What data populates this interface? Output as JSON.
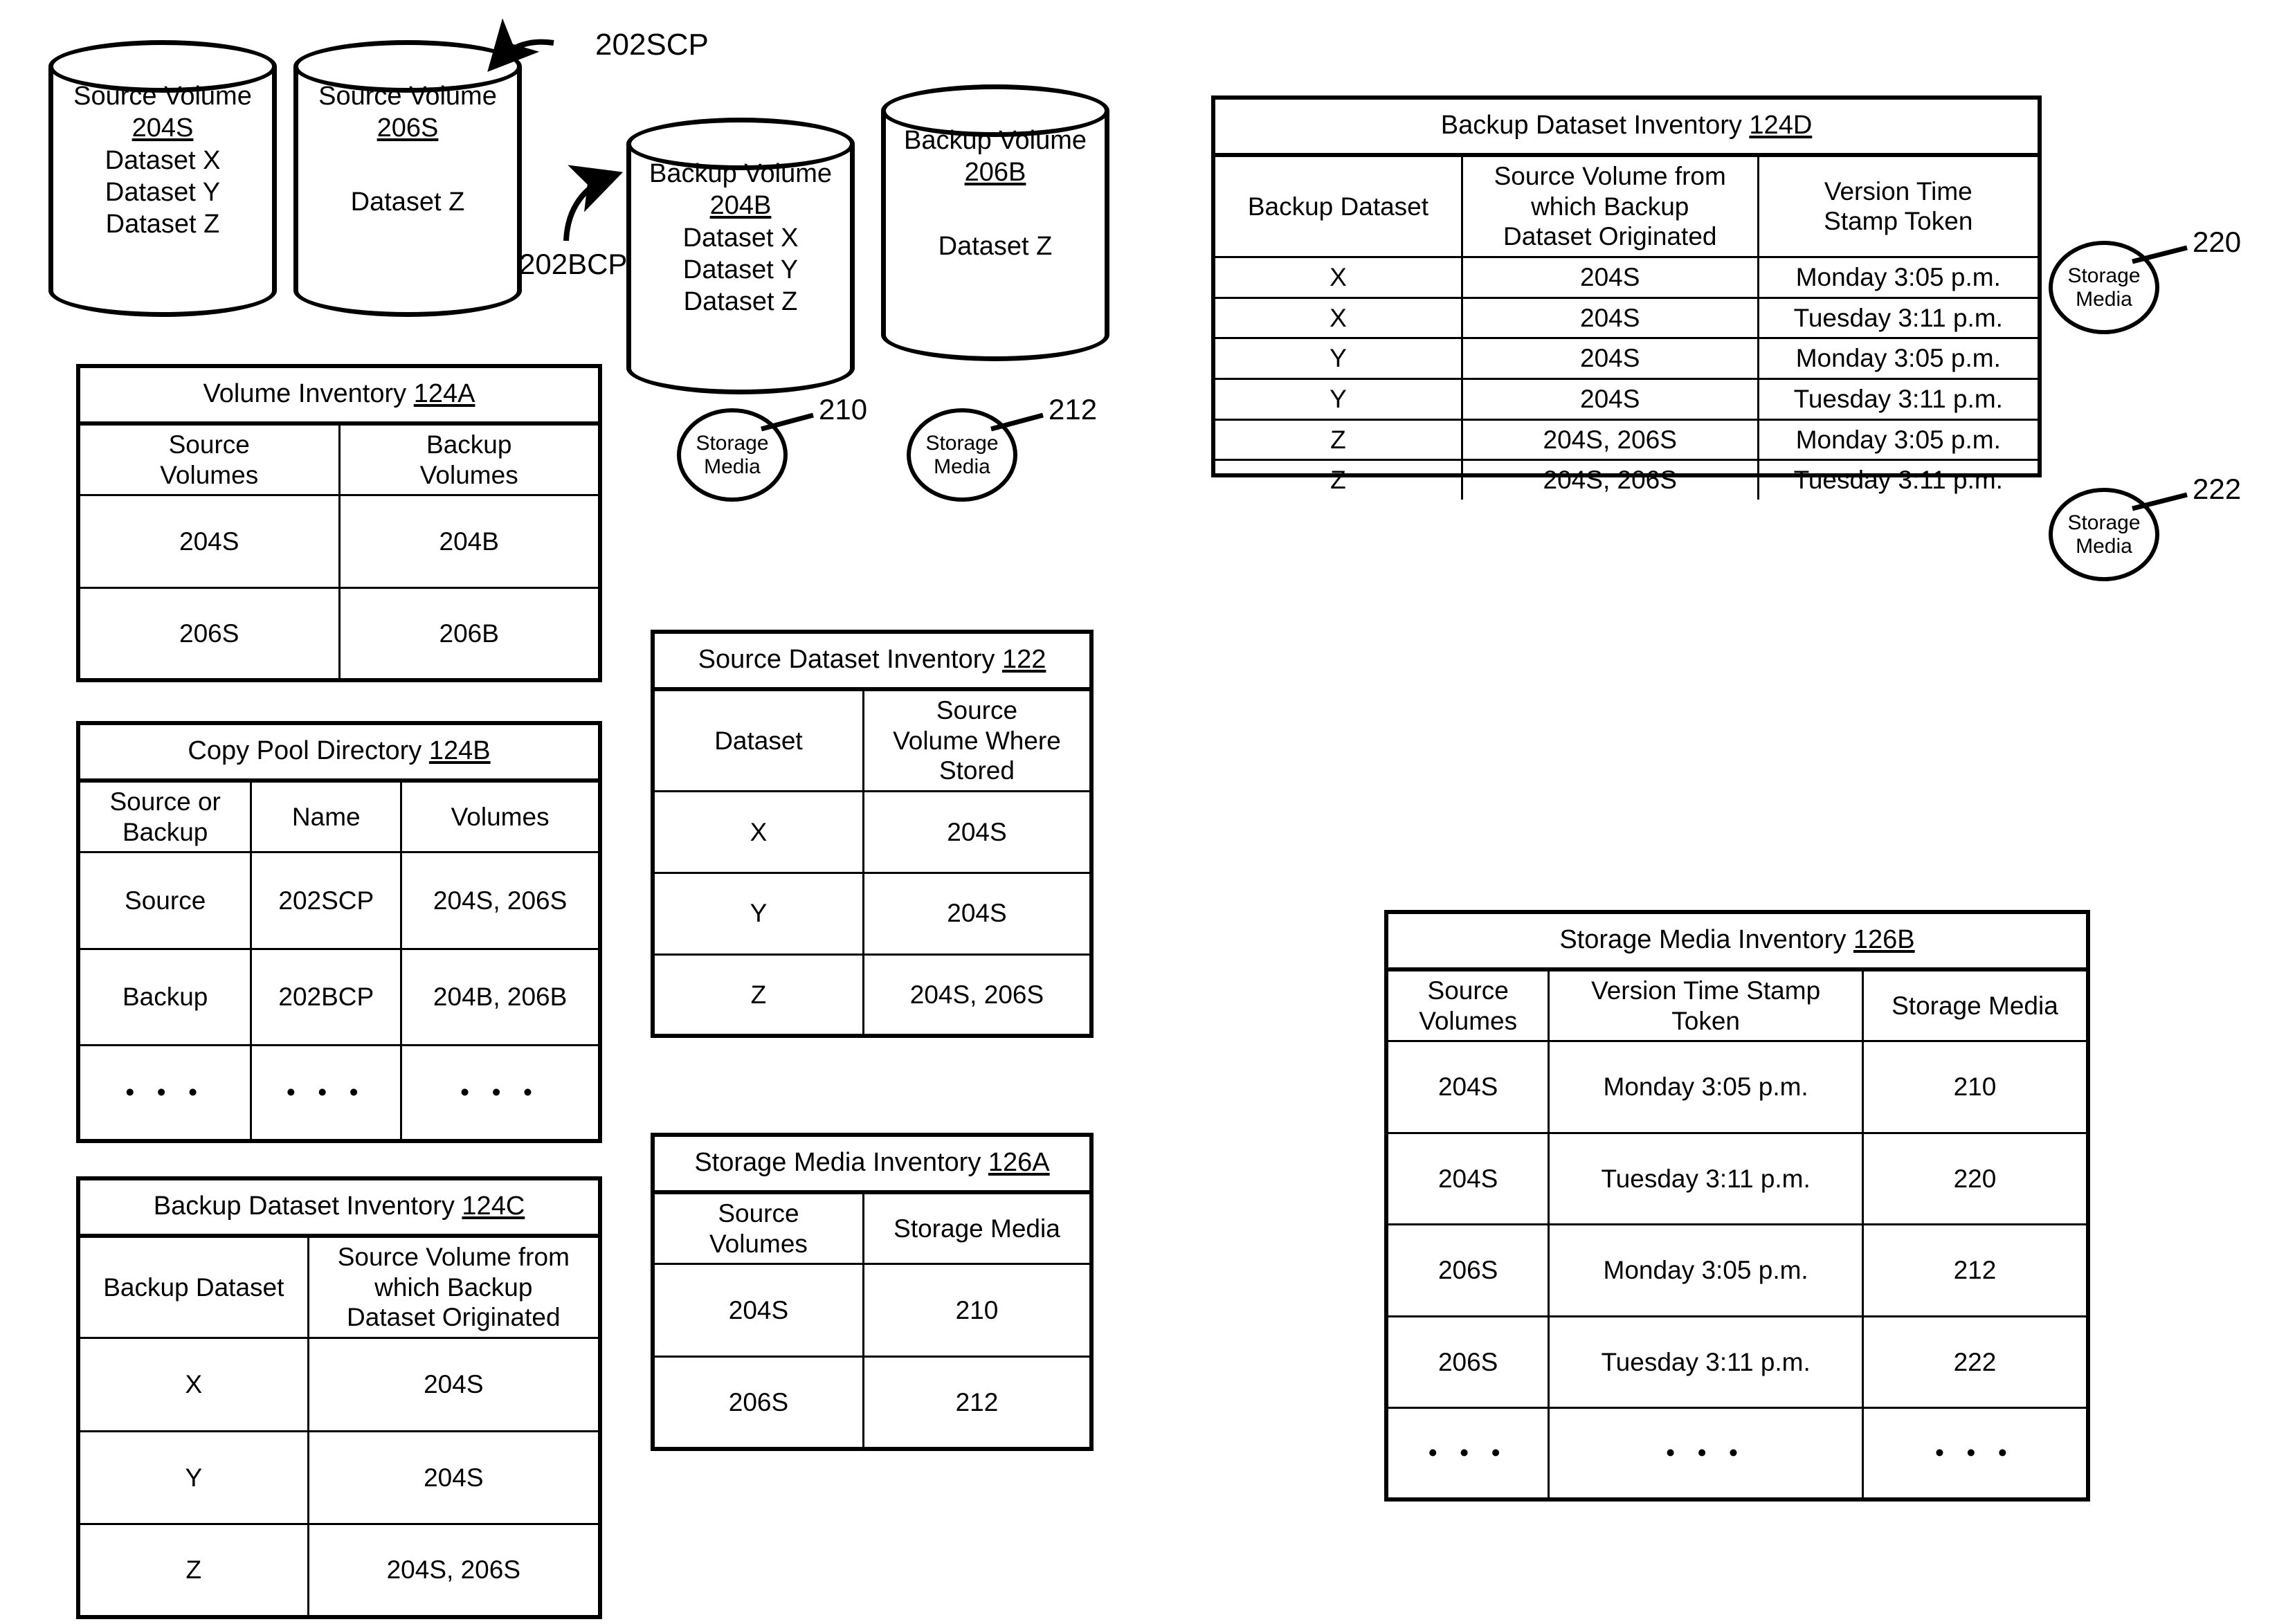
{
  "figure": {
    "volumes": [
      {
        "id": "source-volume-204S",
        "title": "Source Volume",
        "ref": "204S",
        "datasets": [
          "Dataset X",
          "Dataset Y",
          "Dataset Z"
        ]
      },
      {
        "id": "source-volume-206S",
        "title": "Source Volume",
        "ref": "206S",
        "datasets": [
          "Dataset Z"
        ]
      },
      {
        "id": "backup-volume-204B",
        "title": "Backup Volume",
        "ref": "204B",
        "datasets": [
          "Dataset X",
          "Dataset Y",
          "Dataset Z"
        ]
      },
      {
        "id": "backup-volume-206B",
        "title": "Backup Volume",
        "ref": "206B",
        "datasets": [
          "Dataset Z"
        ]
      }
    ],
    "copy_pool_labels": {
      "source_copy_pool": "202SCP",
      "backup_copy_pool": "202BCP"
    },
    "storage_media": [
      {
        "label": "Storage Media",
        "ref": "210"
      },
      {
        "label": "Storage Media",
        "ref": "212"
      },
      {
        "label": "Storage Media",
        "ref": "220"
      },
      {
        "label": "Storage Media",
        "ref": "222"
      }
    ]
  },
  "tables": {
    "volume_inventory": {
      "title": "Volume Inventory ",
      "ref": "124A",
      "columns": [
        "Source\nVolumes",
        "Backup\nVolumes"
      ],
      "columns_display": [
        [
          "Source",
          "Volumes"
        ],
        [
          "Backup",
          "Volumes"
        ]
      ],
      "rows": [
        [
          "204S",
          "204B"
        ],
        [
          "206S",
          "206B"
        ]
      ]
    },
    "copy_pool_directory": {
      "title": "Copy Pool Directory ",
      "ref": "124B",
      "columns_display": [
        [
          "Source or",
          "Backup"
        ],
        [
          "Name"
        ],
        [
          "Volumes"
        ]
      ],
      "rows": [
        [
          "Source",
          "202SCP",
          "204S, 206S"
        ],
        [
          "Backup",
          "202BCP",
          "204B, 206B"
        ],
        [
          "• • •",
          "• • •",
          "• • •"
        ]
      ]
    },
    "backup_dataset_inventory_124C": {
      "title": "Backup Dataset Inventory ",
      "ref": "124C",
      "columns_display": [
        [
          "Backup Dataset"
        ],
        [
          "Source Volume from",
          "which Backup",
          "Dataset Originated"
        ]
      ],
      "rows": [
        [
          "X",
          "204S"
        ],
        [
          "Y",
          "204S"
        ],
        [
          "Z",
          "204S, 206S"
        ]
      ]
    },
    "source_dataset_inventory": {
      "title": "Source Dataset Inventory ",
      "ref": "122",
      "columns_display": [
        [
          "Dataset"
        ],
        [
          "Source",
          "Volume Where",
          "Stored"
        ]
      ],
      "rows": [
        [
          "X",
          "204S"
        ],
        [
          "Y",
          "204S"
        ],
        [
          "Z",
          "204S, 206S"
        ]
      ]
    },
    "storage_media_inventory_126A": {
      "title": "Storage Media Inventory ",
      "ref": "126A",
      "columns_display": [
        [
          "Source",
          "Volumes"
        ],
        [
          "Storage Media"
        ]
      ],
      "rows": [
        [
          "204S",
          "210"
        ],
        [
          "206S",
          "212"
        ]
      ]
    },
    "backup_dataset_inventory_124D": {
      "title": "Backup Dataset Inventory ",
      "ref": "124D",
      "columns_display": [
        [
          "Backup Dataset"
        ],
        [
          "Source Volume from",
          "which Backup",
          "Dataset Originated"
        ],
        [
          "Version Time",
          "Stamp Token"
        ]
      ],
      "rows": [
        [
          "X",
          "204S",
          "Monday 3:05 p.m."
        ],
        [
          "X",
          "204S",
          "Tuesday 3:11 p.m."
        ],
        [
          "Y",
          "204S",
          "Monday 3:05 p.m."
        ],
        [
          "Y",
          "204S",
          "Tuesday 3:11 p.m."
        ],
        [
          "Z",
          "204S, 206S",
          "Monday 3:05 p.m."
        ],
        [
          "Z",
          "204S, 206S",
          "Tuesday 3:11 p.m."
        ]
      ]
    },
    "storage_media_inventory_126B": {
      "title": "Storage Media Inventory ",
      "ref": "126B",
      "columns_display": [
        [
          "Source",
          "Volumes"
        ],
        [
          "Version Time Stamp",
          "Token"
        ],
        [
          "Storage Media"
        ]
      ],
      "rows": [
        [
          "204S",
          "Monday 3:05 p.m.",
          "210"
        ],
        [
          "204S",
          "Tuesday 3:11 p.m.",
          "220"
        ],
        [
          "206S",
          "Monday 3:05 p.m.",
          "212"
        ],
        [
          "206S",
          "Tuesday 3:11 p.m.",
          "222"
        ],
        [
          "• • •",
          "• • •",
          "• • •"
        ]
      ]
    }
  }
}
